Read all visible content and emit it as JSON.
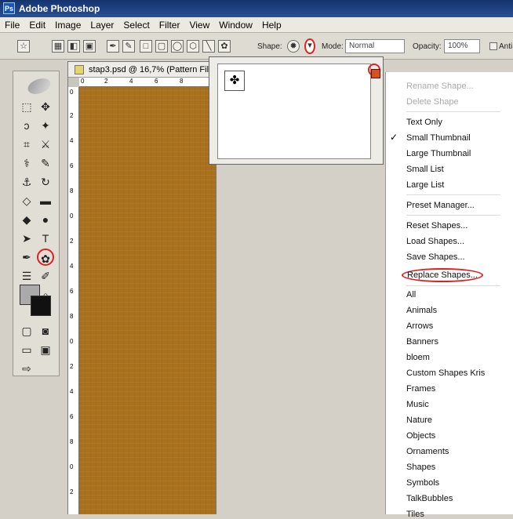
{
  "app": {
    "title": "Adobe Photoshop"
  },
  "menu": [
    "File",
    "Edit",
    "Image",
    "Layer",
    "Select",
    "Filter",
    "View",
    "Window",
    "Help"
  ],
  "options": {
    "shape_label": "Shape:",
    "mode_label": "Mode:",
    "mode_value": "Normal",
    "opacity_label": "Opacity:",
    "opacity_value": "100%",
    "anti_label": "Anti"
  },
  "document": {
    "title": "stap3.psd @ 16,7% (Pattern Fill 1",
    "ruler_top": [
      "0",
      "2",
      "4",
      "6",
      "8"
    ],
    "ruler_left": [
      "0",
      "2",
      "4",
      "6",
      "8",
      "0",
      "2",
      "4",
      "6",
      "8",
      "0",
      "2",
      "4",
      "6",
      "8",
      "0",
      "2",
      "4",
      "6",
      "8"
    ],
    "fill_color": "#a9711e"
  },
  "shape_menu": {
    "items": [
      {
        "label": "Rename Shape...",
        "disabled": true
      },
      {
        "label": "Delete Shape",
        "disabled": true
      },
      {
        "label": "Text Only"
      },
      {
        "label": "Small Thumbnail",
        "checked": true
      },
      {
        "label": "Large Thumbnail"
      },
      {
        "label": "Small List"
      },
      {
        "label": "Large List"
      },
      {
        "label": "Preset Manager..."
      },
      {
        "label": "Reset Shapes..."
      },
      {
        "label": "Load Shapes..."
      },
      {
        "label": "Save Shapes..."
      },
      {
        "label": "Replace Shapes...",
        "highlighted": true
      },
      {
        "label": "All"
      },
      {
        "label": "Animals"
      },
      {
        "label": "Arrows"
      },
      {
        "label": "Banners"
      },
      {
        "label": "bloem"
      },
      {
        "label": "Custom Shapes Kris"
      },
      {
        "label": "Frames"
      },
      {
        "label": "Music"
      },
      {
        "label": "Nature"
      },
      {
        "label": "Objects"
      },
      {
        "label": "Ornaments"
      },
      {
        "label": "Shapes"
      },
      {
        "label": "Symbols"
      },
      {
        "label": "TalkBubbles"
      },
      {
        "label": "Tiles"
      }
    ]
  },
  "colors": {
    "annotation_red": "#d22222",
    "title_blue": "#14336e"
  }
}
